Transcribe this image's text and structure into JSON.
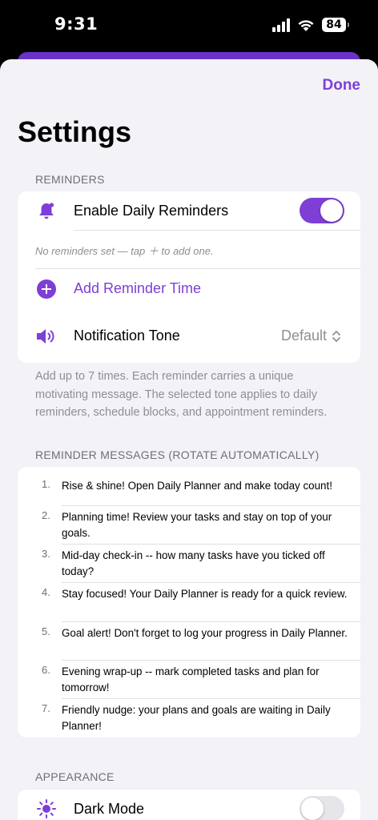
{
  "status": {
    "time": "9:31",
    "battery": "84"
  },
  "colors": {
    "accent": "#7d3fd6",
    "background": "#f2f2f7"
  },
  "nav": {
    "done_label": "Done",
    "title": "Settings"
  },
  "reminders": {
    "header": "REMINDERS",
    "enable_label": "Enable Daily Reminders",
    "enable_on": true,
    "enable_icon": "bell-icon",
    "hint": "No reminders set — tap ＋ to add one.",
    "add_label": "Add Reminder Time",
    "add_icon": "plus-circle-icon",
    "tone_label": "Notification Tone",
    "tone_icon": "speaker-icon",
    "tone_value": "Default",
    "footer": "Add up to 7 times. Each reminder carries a unique motivating message. The selected tone applies to daily reminders, schedule blocks, and appointment reminders."
  },
  "messages": {
    "header": "REMINDER MESSAGES (ROTATE AUTOMATICALLY)",
    "items": [
      {
        "num": "1.",
        "text": "Rise & shine! Open Daily Planner and make today count!"
      },
      {
        "num": "2.",
        "text": "Planning time! Review your tasks and stay on top of your goals."
      },
      {
        "num": "3.",
        "text": "Mid-day check-in -- how many tasks have you ticked off today?"
      },
      {
        "num": "4.",
        "text": "Stay focused! Your Daily Planner is ready for a quick review."
      },
      {
        "num": "5.",
        "text": "Goal alert! Don't forget to log your progress in Daily Planner."
      },
      {
        "num": "6.",
        "text": "Evening wrap-up -- mark completed tasks and plan for tomorrow!"
      },
      {
        "num": "7.",
        "text": "Friendly nudge: your plans and goals are waiting in Daily Planner!"
      }
    ]
  },
  "appearance": {
    "header": "APPEARANCE",
    "dark_mode_label": "Dark Mode",
    "dark_mode_icon": "sun-icon",
    "dark_mode_on": false
  }
}
